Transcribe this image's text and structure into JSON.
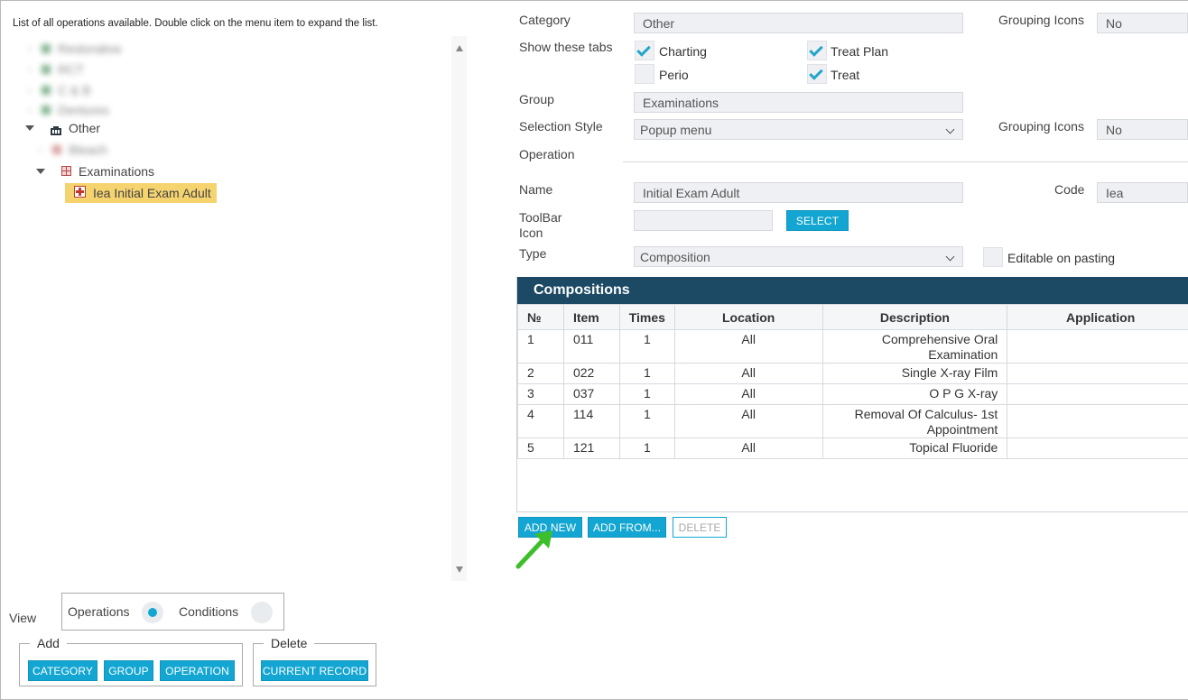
{
  "hint": "List of all operations available. Double click on the menu item to expand the list.",
  "tree": {
    "blurred_items": [
      "Restorative",
      "RCT",
      "C & B",
      "Dentures"
    ],
    "category": "Other",
    "blurred_group": "Bleach",
    "group": "Examinations",
    "selected_operation": "Iea Initial Exam Adult"
  },
  "form": {
    "category_label": "Category",
    "category_value": "Other",
    "grouping_icons_label": "Grouping Icons",
    "grouping_icons_value": "No",
    "show_tabs_label": "Show these tabs",
    "tabs": [
      {
        "label": "Charting",
        "checked": true
      },
      {
        "label": "Treat Plan",
        "checked": true
      },
      {
        "label": "Perio",
        "checked": false
      },
      {
        "label": "Treat",
        "checked": true
      }
    ],
    "group_label": "Group",
    "group_value": "Examinations",
    "selection_style_label": "Selection Style",
    "selection_style_value": "Popup menu",
    "grouping_icons2_label": "Grouping Icons",
    "grouping_icons2_value": "No",
    "operation_label": "Operation",
    "name_label": "Name",
    "name_value": "Initial Exam Adult",
    "code_label": "Code",
    "code_value": "Iea",
    "toolbar_icon_label_1": "ToolBar",
    "toolbar_icon_label_2": "Icon",
    "select_button": "SELECT",
    "type_label": "Type",
    "type_value": "Composition",
    "editable_label": "Editable on pasting"
  },
  "compositions": {
    "title": "Compositions",
    "columns": [
      "№",
      "Item",
      "Times",
      "Location",
      "Description",
      "Application"
    ],
    "rows": [
      {
        "no": "1",
        "item": "011",
        "times": "1",
        "location": "All",
        "description": "Comprehensive Oral Examination",
        "application": ""
      },
      {
        "no": "2",
        "item": "022",
        "times": "1",
        "location": "All",
        "description": "Single X-ray Film",
        "application": ""
      },
      {
        "no": "3",
        "item": "037",
        "times": "1",
        "location": "All",
        "description": "O P G X-ray",
        "application": ""
      },
      {
        "no": "4",
        "item": "114",
        "times": "1",
        "location": "All",
        "description": "Removal Of Calculus- 1st Appointment",
        "application": ""
      },
      {
        "no": "5",
        "item": "121",
        "times": "1",
        "location": "All",
        "description": "Topical Fluoride",
        "application": ""
      }
    ],
    "add_new": "ADD NEW",
    "add_from": "ADD FROM...",
    "delete": "DELETE"
  },
  "bottom": {
    "view_label": "View",
    "operations_label": "Operations",
    "conditions_label": "Conditions",
    "add_legend": "Add",
    "category_button": "CATEGORY",
    "group_button": "GROUP",
    "operation_button": "OPERATION",
    "delete_legend": "Delete",
    "current_record_button": "CURRENT RECORD"
  },
  "colors": {
    "accent": "#13a6d2",
    "header": "#1c4963",
    "selected": "#f5d36e",
    "arrow": "#3cbf2a"
  }
}
